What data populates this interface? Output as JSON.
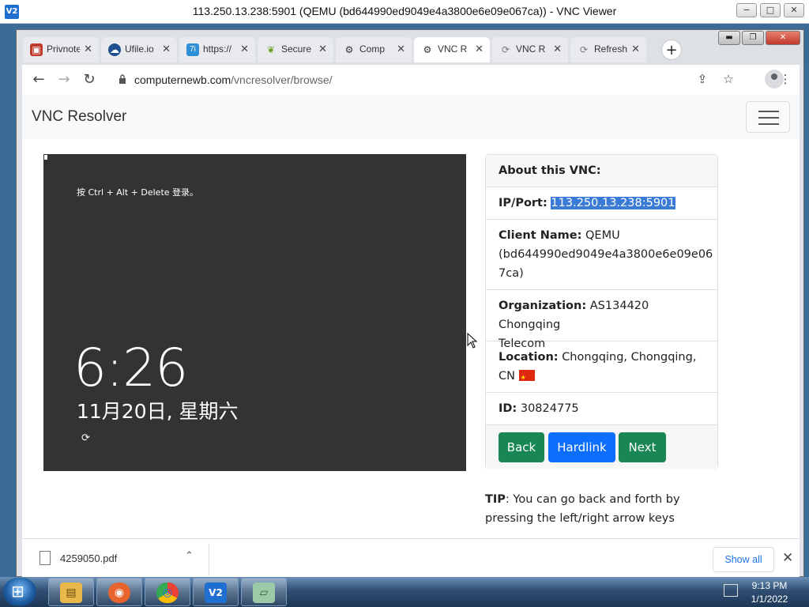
{
  "vnc": {
    "title": "113.250.13.238:5901 (QEMU (bd644990ed9049e4a3800e6e09e067ca)) - VNC Viewer",
    "logo": "V2",
    "minimize": "−",
    "restore": "□",
    "close": "✕"
  },
  "chrome": {
    "tabs": [
      {
        "label": "Privnote",
        "icon": "lock-red-icon"
      },
      {
        "label": "Ufile.io",
        "icon": "cloud-icon"
      },
      {
        "label": "https://",
        "icon": "7i-icon"
      },
      {
        "label": "Secure",
        "icon": "leaf-icon"
      },
      {
        "label": "Comp",
        "icon": "vnc-icon"
      },
      {
        "label": "VNC R",
        "icon": "vnc-icon"
      },
      {
        "label": "VNC R",
        "icon": "refresh-icon"
      },
      {
        "label": "Refresh",
        "icon": "refresh-icon"
      }
    ],
    "active_tab": 5,
    "new_tab": "+",
    "window_buttons": {
      "minimize": "▬",
      "restore": "❐",
      "close": "✕"
    },
    "toolbar": {
      "back": "←",
      "forward": "→",
      "reload": "↻",
      "share": "⇪",
      "bookmark": "☆",
      "menu": "⋮"
    },
    "url_host": "computernewb.com",
    "url_path": "/vncresolver/browse/"
  },
  "page": {
    "brand": "VNC Resolver",
    "screen": {
      "hint": "按 Ctrl + Alt + Delete 登录。",
      "time": "6:26",
      "date": "11月20日, 星期六",
      "accessibility": "⟳"
    },
    "card": {
      "header": "About this VNC:",
      "ip_label": "IP/Port:",
      "ip_value": "113.250.13.238:5901",
      "client_label": "Client Name:",
      "client_value_1": "QEMU",
      "client_value_2": "(bd644990ed9049e4a3800e6e09e06",
      "client_value_3": "7ca)",
      "org_label": "Organization:",
      "org_value_1": "AS134420 Chongqing",
      "org_value_2": "Telecom",
      "loc_label": "Location:",
      "loc_value_1": "Chongqing, Chongqing,",
      "loc_value_2": "CN",
      "id_label": "ID:",
      "id_value": "30824775",
      "back": "Back",
      "hardlink": "Hardlink",
      "next": "Next"
    },
    "tip_label": "TIP",
    "tip_text": ": You can go back and forth by pressing the left/right arrow keys"
  },
  "downloads": {
    "file_name": "4259050.pdf",
    "chevron": "⌃",
    "show_all": "Show all",
    "close": "✕"
  },
  "taskbar": {
    "apps": [
      {
        "name": "explorer-icon",
        "glyph": "▤",
        "color": "#e8b84a"
      },
      {
        "name": "firefox-icon",
        "glyph": "◉",
        "color": "#e8642c"
      },
      {
        "name": "chrome-icon",
        "glyph": "◎",
        "color": "#34a853"
      },
      {
        "name": "vnc-viewer-icon",
        "glyph": "V2",
        "color": "#1f6fd0"
      },
      {
        "name": "notepad-icon",
        "glyph": "▱",
        "color": "#9cc9a8"
      }
    ],
    "time": "9:13 PM",
    "date": "1/1/2022"
  }
}
